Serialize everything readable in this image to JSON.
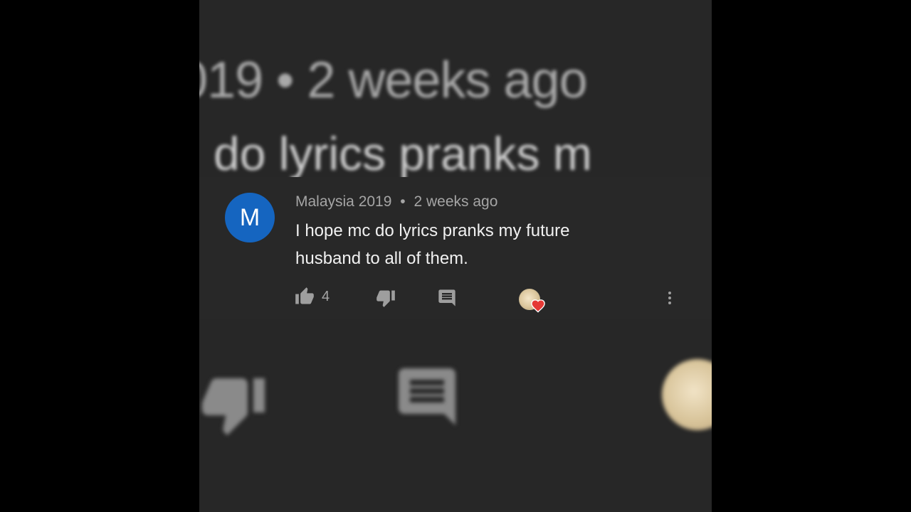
{
  "comment": {
    "avatar_letter": "M",
    "author": "Malaysia 2019",
    "separator": "•",
    "time_ago": "2 weeks ago",
    "text": "I hope mc do lyrics pranks my future husband to all of them.",
    "like_count": "4"
  },
  "background_zoom": {
    "meta_text": "019 • 2 weeks ago",
    "body_text": "do lyrics pranks m"
  },
  "colors": {
    "avatar_bg": "#1565c0",
    "heart": "#e53935",
    "surface": "#282828"
  },
  "icons": [
    "thumbs-up-icon",
    "thumbs-down-icon",
    "reply-icon",
    "creator-heart-icon",
    "more-vert-icon"
  ]
}
